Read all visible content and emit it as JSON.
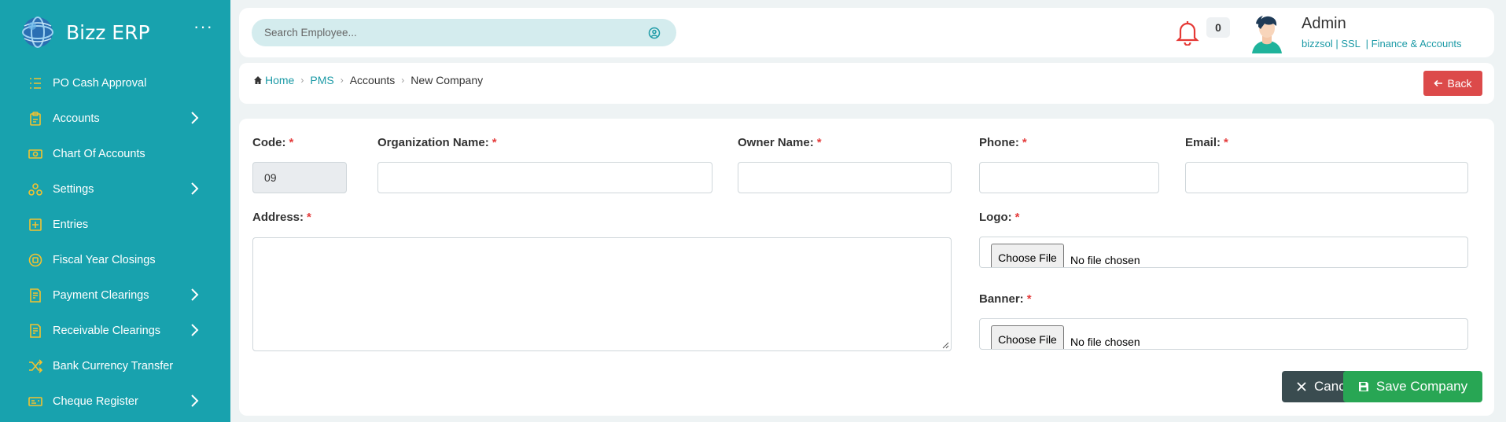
{
  "sidebar": {
    "brand": "Bizz ERP",
    "more_icon": "more-dots-icon",
    "items": [
      {
        "label": "PO Cash Approval",
        "icon": "list-icon",
        "has_children": false
      },
      {
        "label": "Accounts",
        "icon": "clipboard-icon",
        "has_children": true
      },
      {
        "label": "Chart Of Accounts",
        "icon": "money-icon",
        "has_children": false
      },
      {
        "label": "Settings",
        "icon": "settings-icon",
        "has_children": true
      },
      {
        "label": "Entries",
        "icon": "plus-box-icon",
        "has_children": false
      },
      {
        "label": "Fiscal Year Closings",
        "icon": "coin-icon",
        "has_children": false
      },
      {
        "label": "Payment Clearings",
        "icon": "invoice-icon",
        "has_children": true
      },
      {
        "label": "Receivable Clearings",
        "icon": "invoice-icon",
        "has_children": true
      },
      {
        "label": "Bank Currency Transfer",
        "icon": "shuffle-icon",
        "has_children": false
      },
      {
        "label": "Cheque Register",
        "icon": "cheque-icon",
        "has_children": true
      }
    ]
  },
  "header": {
    "search_placeholder": "Search Employee...",
    "notification_count": "0",
    "user_name": "Admin",
    "user_meta": "bizzsol | SSL  | Finance & Accounts"
  },
  "breadcrumb": {
    "home": "Home",
    "items": [
      "PMS",
      "Accounts",
      "New Company"
    ],
    "back_label": "Back"
  },
  "form": {
    "code_label": "Code:",
    "code_value": "09",
    "org_label": "Organization Name:",
    "owner_label": "Owner Name:",
    "phone_label": "Phone:",
    "email_label": "Email:",
    "address_label": "Address:",
    "logo_label": "Logo:",
    "banner_label": "Banner:",
    "choose_file": "Choose File",
    "no_file": "No file chosen",
    "required_mark": "*",
    "cancel_label": "Cancel",
    "save_label": "Save Company"
  },
  "colors": {
    "sidebar": "#18a2ae",
    "icon_gold": "#f2c230",
    "back": "#dc4a4a",
    "cancel": "#3a4c50",
    "save": "#28a654",
    "accent": "#1c9aa6"
  }
}
